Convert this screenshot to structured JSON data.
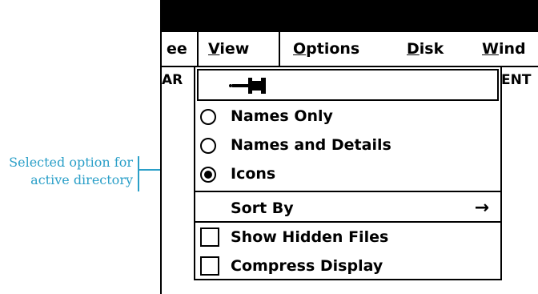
{
  "menubar": {
    "items": [
      {
        "label": "ee"
      },
      {
        "label": "View"
      },
      {
        "label": "Options"
      },
      {
        "label": "Disk"
      },
      {
        "label": "Wind"
      }
    ]
  },
  "background": {
    "left_fragment": "AR",
    "right_fragment": "ENT"
  },
  "view_menu": {
    "pin_icon": "pushpin-icon",
    "options": [
      {
        "label": "Names Only",
        "selected": false
      },
      {
        "label": "Names and Details",
        "selected": false
      },
      {
        "label": "Icons",
        "selected": true
      }
    ],
    "sort_by": {
      "label": "Sort By",
      "arrow": "→"
    },
    "toggles": [
      {
        "label": "Show Hidden Files",
        "checked": false
      },
      {
        "label": "Compress Display",
        "checked": false
      }
    ]
  },
  "annotation": {
    "line1": "Selected option for",
    "line2": "active directory",
    "color": "#2a9fc8"
  }
}
